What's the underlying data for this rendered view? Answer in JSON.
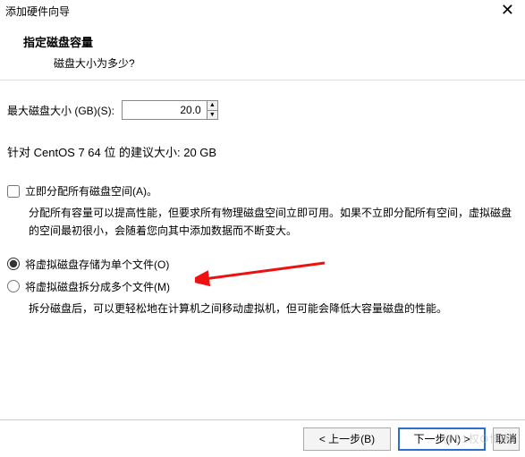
{
  "window": {
    "title": "添加硬件向导",
    "close_glyph": "✕"
  },
  "header": {
    "title": "指定磁盘容量",
    "subtitle": "磁盘大小为多少?"
  },
  "max_size": {
    "label": "最大磁盘大小 (GB)(S):",
    "value": "20.0",
    "up": "▲",
    "down": "▼"
  },
  "recommend": "针对 CentOS 7 64 位 的建议大小: 20 GB",
  "allocate_now": {
    "label": "立即分配所有磁盘空间(A)。",
    "desc": "分配所有容量可以提高性能，但要求所有物理磁盘空间立即可用。如果不立即分配所有空间，虚拟磁盘的空间最初很小，会随着您向其中添加数据而不断变大。"
  },
  "store_single": {
    "label": "将虚拟磁盘存储为单个文件(O)"
  },
  "store_split": {
    "label": "将虚拟磁盘拆分成多个文件(M)",
    "desc": "拆分磁盘后，可以更轻松地在计算机之间移动虚拟机，但可能会降低大容量磁盘的性能。"
  },
  "footer": {
    "back": "< 上一步(B)",
    "next": "下一步(N) >",
    "cancel": "取消"
  },
  "watermark": "@51权O博客"
}
